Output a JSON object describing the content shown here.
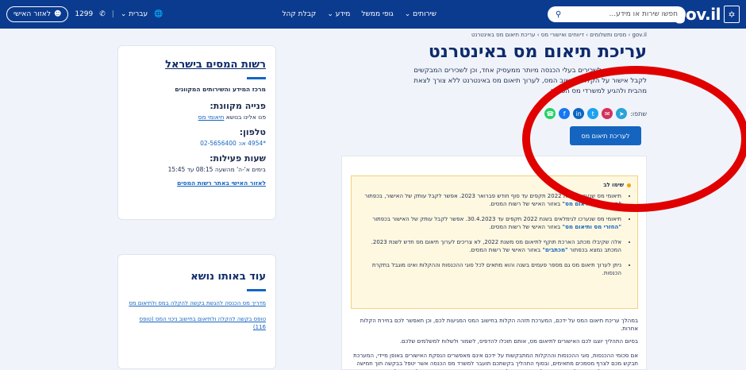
{
  "header": {
    "logo_text": "gov.il",
    "logo_emblem": "✡",
    "search_placeholder": "חפשו שירות או מידע...",
    "search_icon": "magnifier-icon",
    "nav": [
      {
        "label": "שירותים ⌄"
      },
      {
        "label": "גופי ממשל"
      },
      {
        "label": "מידע ⌄"
      },
      {
        "label": "קבלת קהל"
      }
    ],
    "language": "עברית ⌄",
    "hotline": "1299",
    "login": "לאזור האישי"
  },
  "breadcrumb": "gov.il › מסים ותשלומים › דיווחים ואישורי מס › עריכת תיאום מס באינטרנט",
  "page_title": "עריכת תיאום מס באינטרנט",
  "intro": "שירות זה מיועד לשכירים בעלי הכנסה מיותר ממעסיק אחד, וכן לשכירים המבקשים לקבל אישור על הקלה בחישוב המס, לערוך תיאום מס באינטרנט ללא צורך לצאת מהבית ולהגיע למשרדי מס הכנסה.",
  "share": {
    "label": "שתפו:",
    "channels": [
      {
        "name": "telegram-icon",
        "glyph": "➤",
        "color": "#2aa3d8"
      },
      {
        "name": "mail-icon",
        "glyph": "✉",
        "color": "#d3325c"
      },
      {
        "name": "twitter-icon",
        "glyph": "t",
        "color": "#1da1f2"
      },
      {
        "name": "linkedin-icon",
        "glyph": "in",
        "color": "#0a66c2"
      },
      {
        "name": "facebook-icon",
        "glyph": "f",
        "color": "#1877f2"
      },
      {
        "name": "whatsapp-icon",
        "glyph": "☎",
        "color": "#25d366"
      }
    ]
  },
  "cta": "לעריכת תיאום מס",
  "notice": {
    "heading": "שימו לב",
    "items": [
      {
        "text": "תיאומי מס שנערכו בשנת 2022 תקפים עד סוף חודש פברואר 2023. אפשר לקבל עותק של האישור, בכפתור ",
        "link": "\"החזרי מס ותיאום מס\"",
        "after": " באזור האישי של רשות המסים."
      },
      {
        "text": "תיאומי מס שנערכו לגימלאים בשנת 2022 תקפים עד 30.4.2023. אפשר לקבל עותק של האישור בכפתור ",
        "link": "\"החזרי מס ותיאום מס\"",
        "after": " באזור האישי של רשות המסים."
      },
      {
        "text": "אלה שקיבלו מכתב הארכת תוקף לתיאום מס משנת 2022, לא צריכים לערוך תיאום מס חדש לשנת 2023. המכתב נמצא בכפתור ",
        "link": "\"מכתבים\"",
        "after": " באזור האישי של רשות המסים."
      },
      {
        "text": "ניתן לערוך תיאום מס גם מספר פעמים בשנה והוא מתאים לכל סוגי ההכנסות וההקלות ואינו מוגבל בתקרת הכנסות.",
        "link": "",
        "after": ""
      }
    ]
  },
  "paragraphs": [
    "במהלך עריכת תיאום המס על ידכם, המערכת תזהה הקלות בחישוב המס המגיעות לכם, וכן תאפשר לכם בחירת הקלות אחרות.",
    "בסיום התהליך יוצגו לכם האישורים לתיאום מס, אותם תוכלו להדפיס, לשמור ולשלוח למשלמים שלכם.",
    "אם סכומי ההכנסות, סוגי ההכנסות וההקלות המתבקשות על ידכם אינם מאפשרים הנפקת האישורים באופן מיידי, המערכת תבקש מכם לצרף מסמכים מתאימים, ובסוף התהליך בקשתכם תועבר למשרד מס הכנסה אשר יטפל בבקשה תוך חמישה ימי עבודה. בתהליכים יטופל עד מרץ, כשל ריבוי הפניות לעריכת תיאום מס, ייתכן כי משך הטיפול יתארך לעשרה ימי עבודה."
  ],
  "sidebar": {
    "org_title": "רשות המסים בישראל",
    "org_sub": "מרכז המידע והשירותים המקוונים",
    "inquiry_heading": "פנייה מקוונת:",
    "inquiry_text": "פנו אלינו בנושא ",
    "inquiry_link": "תיאומי מס",
    "phone_heading": "טלפון:",
    "phone_text": "*4954 או: 02-5656400",
    "hours_heading": "שעות פעילות:",
    "hours_text": "בימים א'-ה' מהשעה 08:15 עד 15:45",
    "personal_link": "לאזור האישי באתר רשות המסים",
    "related_title": "עוד באותו נושא",
    "related_links": [
      "מדריך מס הכנסה להגשת בקשה להקלה במס ולתיאום מס",
      "טופס בקשה להקלה ולתיאום בחישוב ניכוי המס (טופס 116)"
    ]
  }
}
